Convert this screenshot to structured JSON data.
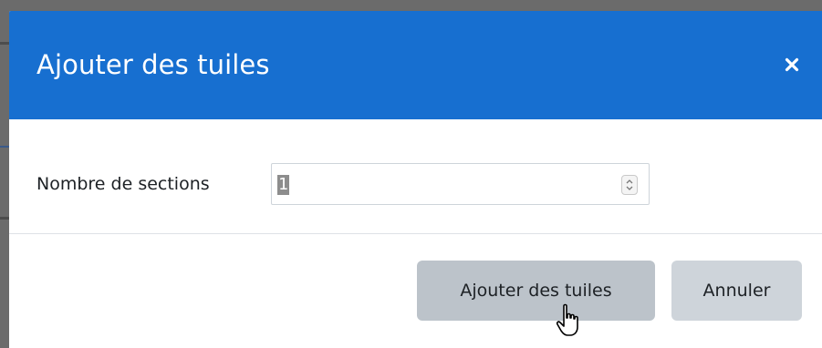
{
  "dialog": {
    "title": "Ajouter des tuiles",
    "close_icon": "close-icon",
    "field": {
      "label": "Nombre de sections",
      "value": "1",
      "spinner_icon": "spinner-arrows-icon"
    },
    "buttons": {
      "add_label": "Ajouter des tuiles",
      "cancel_label": "Annuler"
    }
  },
  "colors": {
    "header": "#176fd0",
    "header_text": "#ffffff",
    "button_add": "#bcc3ca",
    "button_cancel": "#ced4da",
    "overlay": "#6b6b6b"
  },
  "cursor": "hand-pointer-icon"
}
